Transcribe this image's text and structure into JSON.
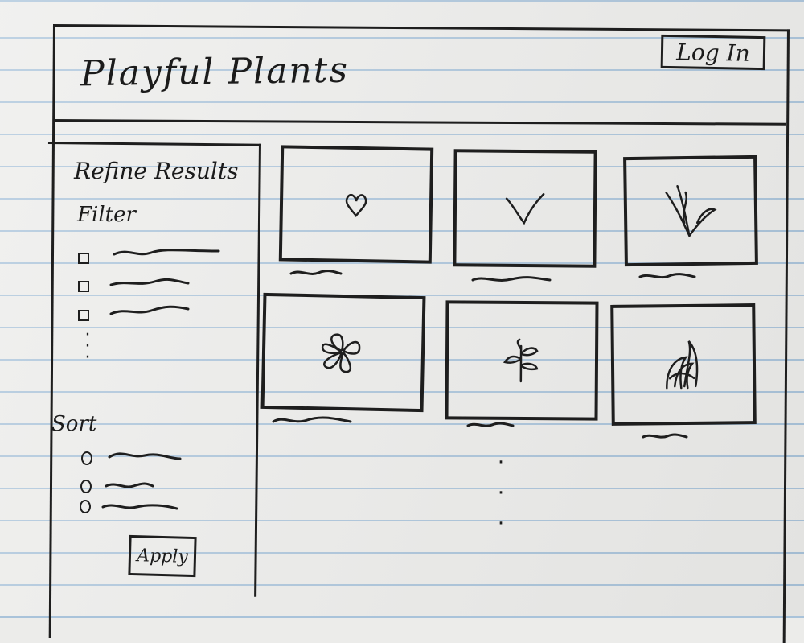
{
  "header": {
    "app_title": "Playful Plants",
    "login_label": "Log In"
  },
  "sidebar": {
    "heading": "Refine Results",
    "filter_heading": "Filter",
    "filter_options": 3,
    "sort_heading": "Sort",
    "sort_options": 3,
    "apply_label": "Apply"
  },
  "products": [
    {
      "icon": "heart-sprout-icon"
    },
    {
      "icon": "v-sprout-icon"
    },
    {
      "icon": "leafy-sprout-icon"
    },
    {
      "icon": "flower-icon"
    },
    {
      "icon": "herb-sprig-icon"
    },
    {
      "icon": "grass-icon"
    }
  ],
  "colors": {
    "paper": "#ececea",
    "rule_line": "#a9c3da",
    "ink": "#1e1e1e"
  }
}
